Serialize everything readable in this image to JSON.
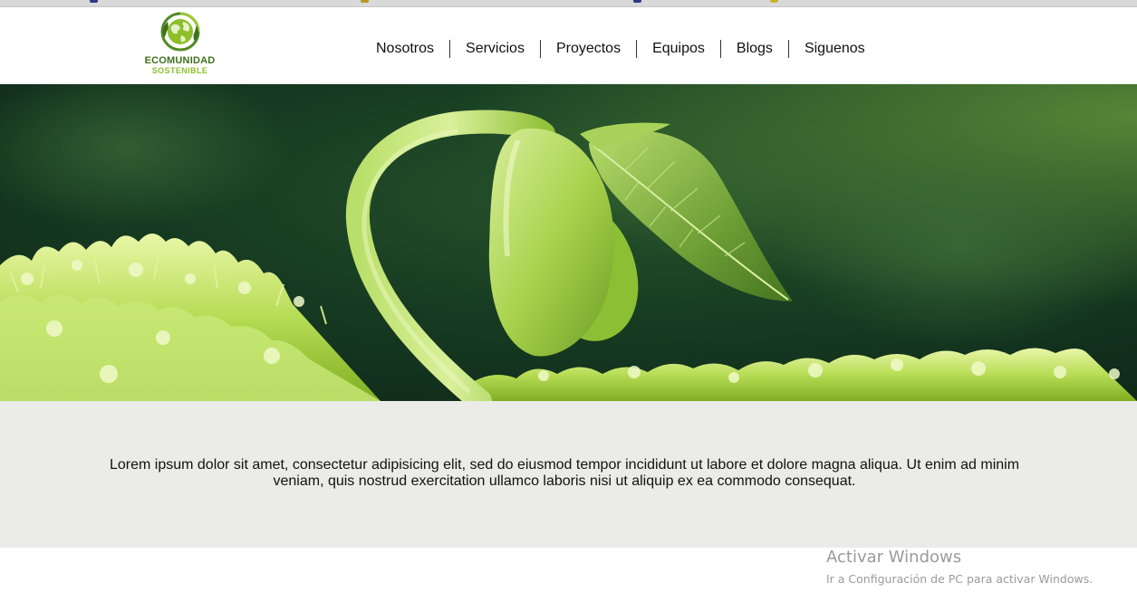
{
  "header": {
    "logo": {
      "name": "ECOMUNIDAD",
      "tagline": "SOSTENIBLE",
      "icon": "globe-leaf-icon"
    },
    "nav": [
      {
        "label": "Nosotros"
      },
      {
        "label": "Servicios"
      },
      {
        "label": "Proyectos"
      },
      {
        "label": "Equipos"
      },
      {
        "label": "Blogs"
      },
      {
        "label": "Siguenos"
      }
    ]
  },
  "hero": {
    "image": "seedling-sprout-photo"
  },
  "intro": {
    "text": "Lorem ipsum dolor sit amet, consectetur adipisicing elit, sed do eiusmod tempor incididunt ut labore et dolore magna aliqua. Ut enim ad minim veniam, quis nostrud exercitation ullamco laboris nisi ut aliquip ex ea commodo consequat."
  },
  "watermark": {
    "title": "Activar Windows",
    "subtitle": "Ir a Configuración de PC para activar Windows."
  },
  "colors": {
    "brand_dark_green": "#3f6f1e",
    "brand_light_green": "#8cbf2a",
    "intro_background": "#ebebe8",
    "watermark_text": "#9a9a9a"
  }
}
